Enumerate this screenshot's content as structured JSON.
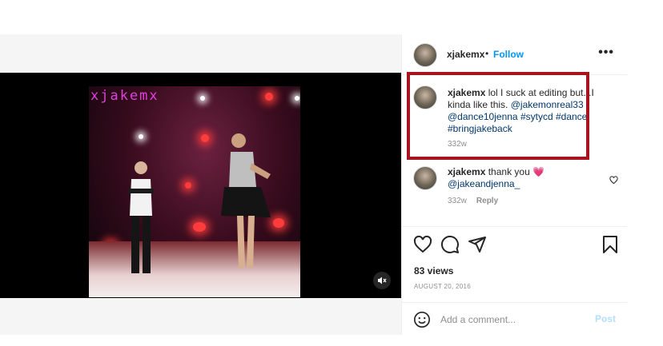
{
  "video": {
    "watermark": "xjakemx"
  },
  "header": {
    "username": "xjakemx",
    "separator": "•",
    "follow_label": "Follow",
    "more_label": "•••"
  },
  "caption": {
    "username": "xjakemx",
    "text": "lol I suck at editing but...I kinda like this.",
    "tags": [
      "@jakemonreal33",
      "@dance10jenna",
      "#sytycd",
      "#dance",
      "#bringjakeback"
    ],
    "time": "332w"
  },
  "comments": [
    {
      "username": "xjakemx",
      "text": "thank you",
      "emoji": "💗",
      "mention": "@jakeandjenna_",
      "time": "332w",
      "reply_label": "Reply"
    }
  ],
  "stats": {
    "views": "83 views",
    "date": "AUGUST 20, 2016"
  },
  "add_comment": {
    "placeholder": "Add a comment...",
    "post_label": "Post"
  },
  "colors": {
    "highlight_border": "#a8141d",
    "link_blue": "#0095f6",
    "tag_blue": "#00376b",
    "muted_gray": "#8e8e8e"
  },
  "icons": [
    "mute-icon",
    "more-options-icon",
    "heart-icon",
    "comment-icon",
    "share-icon",
    "bookmark-icon",
    "emoji-icon",
    "small-heart-icon"
  ]
}
